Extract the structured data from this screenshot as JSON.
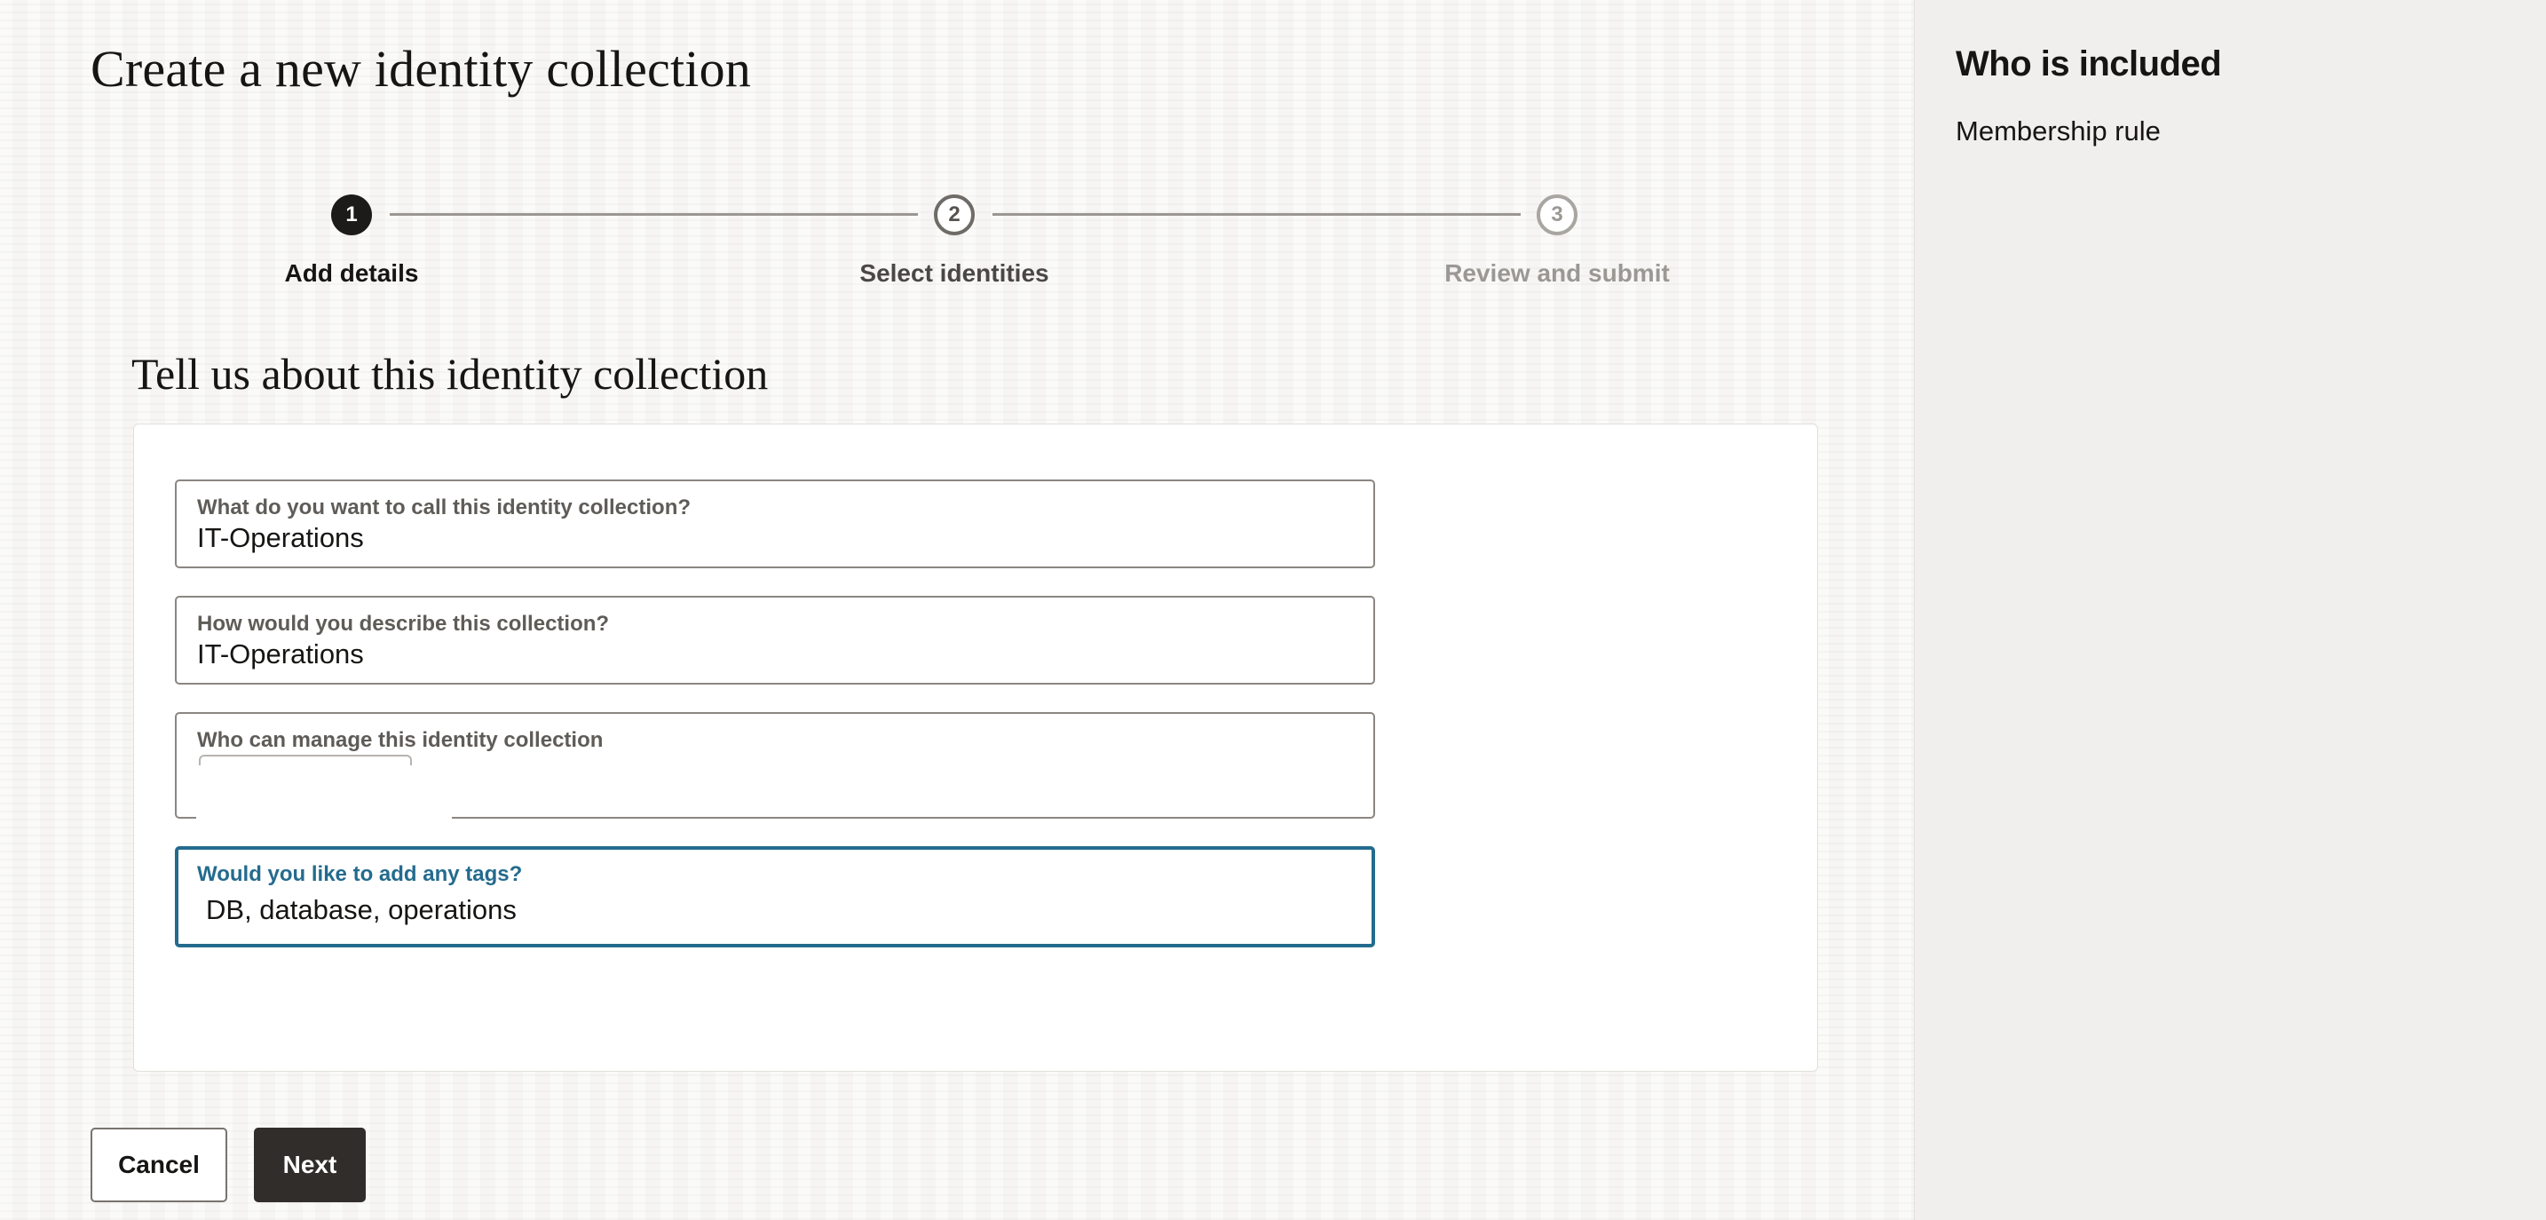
{
  "page": {
    "title": "Create a new identity collection"
  },
  "stepper": {
    "steps": [
      {
        "number": "1",
        "label": "Add details",
        "state": "active"
      },
      {
        "number": "2",
        "label": "Select identities",
        "state": "next"
      },
      {
        "number": "3",
        "label": "Review and submit",
        "state": "future"
      }
    ]
  },
  "form": {
    "section_title": "Tell us about this identity collection",
    "fields": {
      "name": {
        "label": "What do you want to call this identity collection?",
        "value": "IT-Operations"
      },
      "description": {
        "label": "How would you describe this collection?",
        "value": "IT-Operations"
      },
      "managers": {
        "label": "Who can manage this identity collection",
        "value": ""
      },
      "tags": {
        "label": "Would you like to add any tags?",
        "value": "DB, database, operations"
      }
    }
  },
  "actions": {
    "cancel_label": "Cancel",
    "next_label": "Next"
  },
  "side_panel": {
    "title": "Who is included",
    "subtitle": "Membership rule"
  },
  "colors": {
    "primary_button": "#312d2a",
    "focus_accent": "#246b8e",
    "active_step": "#1c1b19"
  }
}
